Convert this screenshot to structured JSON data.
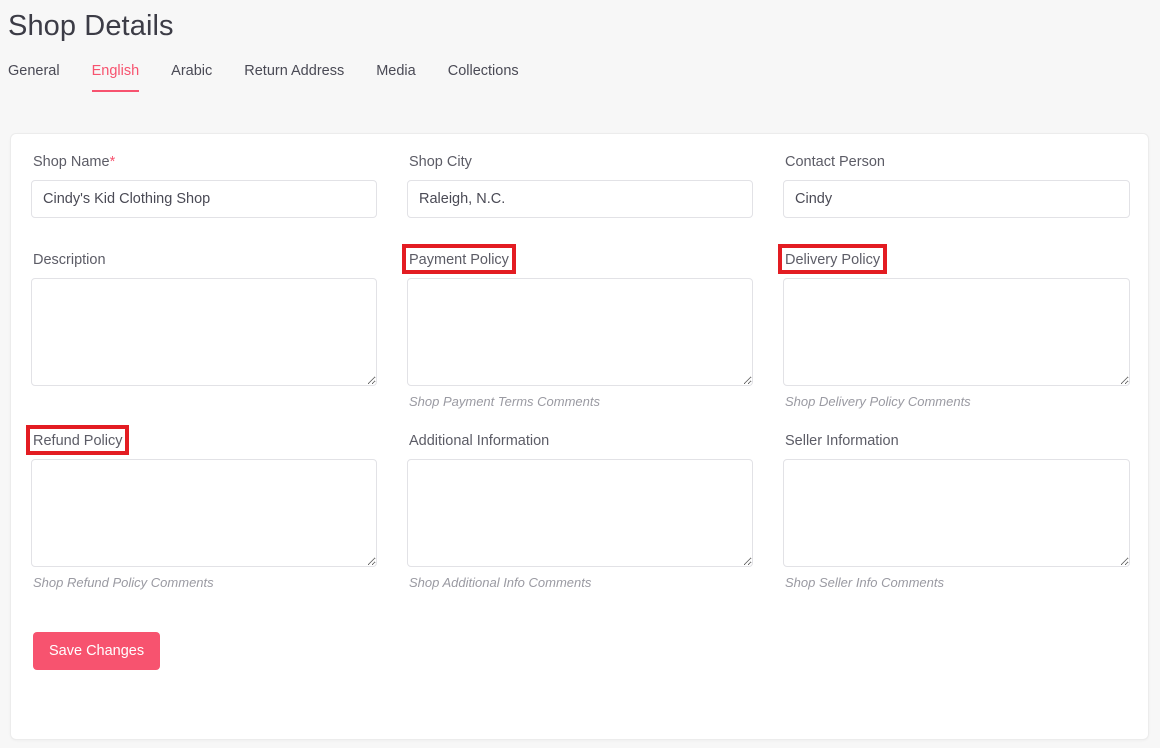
{
  "header": {
    "title": "Shop Details"
  },
  "tabs": [
    {
      "label": "General",
      "active": false
    },
    {
      "label": "English",
      "active": true
    },
    {
      "label": "Arabic",
      "active": false
    },
    {
      "label": "Return Address",
      "active": false
    },
    {
      "label": "Media",
      "active": false
    },
    {
      "label": "Collections",
      "active": false
    }
  ],
  "colors": {
    "accent": "#f7536f",
    "annotation": "#e31c22",
    "page_background": "#f7f7f7",
    "card_background": "#ffffff",
    "label_text": "#5c5c66",
    "helper_text": "#9a9aa2"
  },
  "form": {
    "shop_name": {
      "label": "Shop Name",
      "required_marker": "*",
      "value": "Cindy's Kid Clothing Shop",
      "placeholder": ""
    },
    "shop_city": {
      "label": "Shop City",
      "value": "Raleigh, N.C.",
      "placeholder": ""
    },
    "contact_person": {
      "label": "Contact Person",
      "value": "Cindy",
      "placeholder": ""
    },
    "description": {
      "label": "Description",
      "value": "",
      "placeholder": "",
      "helper": ""
    },
    "payment_policy": {
      "label": "Payment Policy",
      "value": "",
      "placeholder": "",
      "helper": "Shop Payment Terms Comments",
      "highlighted": true
    },
    "delivery_policy": {
      "label": "Delivery Policy",
      "value": "",
      "placeholder": "",
      "helper": "Shop Delivery Policy Comments",
      "highlighted": true
    },
    "refund_policy": {
      "label": "Refund Policy",
      "value": "",
      "placeholder": "",
      "helper": "Shop Refund Policy Comments",
      "highlighted": true
    },
    "additional_information": {
      "label": "Additional Information",
      "value": "",
      "placeholder": "",
      "helper": "Shop Additional Info Comments",
      "highlighted": false
    },
    "seller_information": {
      "label": "Seller Information",
      "value": "",
      "placeholder": "",
      "helper": "Shop Seller Info Comments",
      "highlighted": false
    }
  },
  "actions": {
    "save_label": "Save Changes"
  }
}
